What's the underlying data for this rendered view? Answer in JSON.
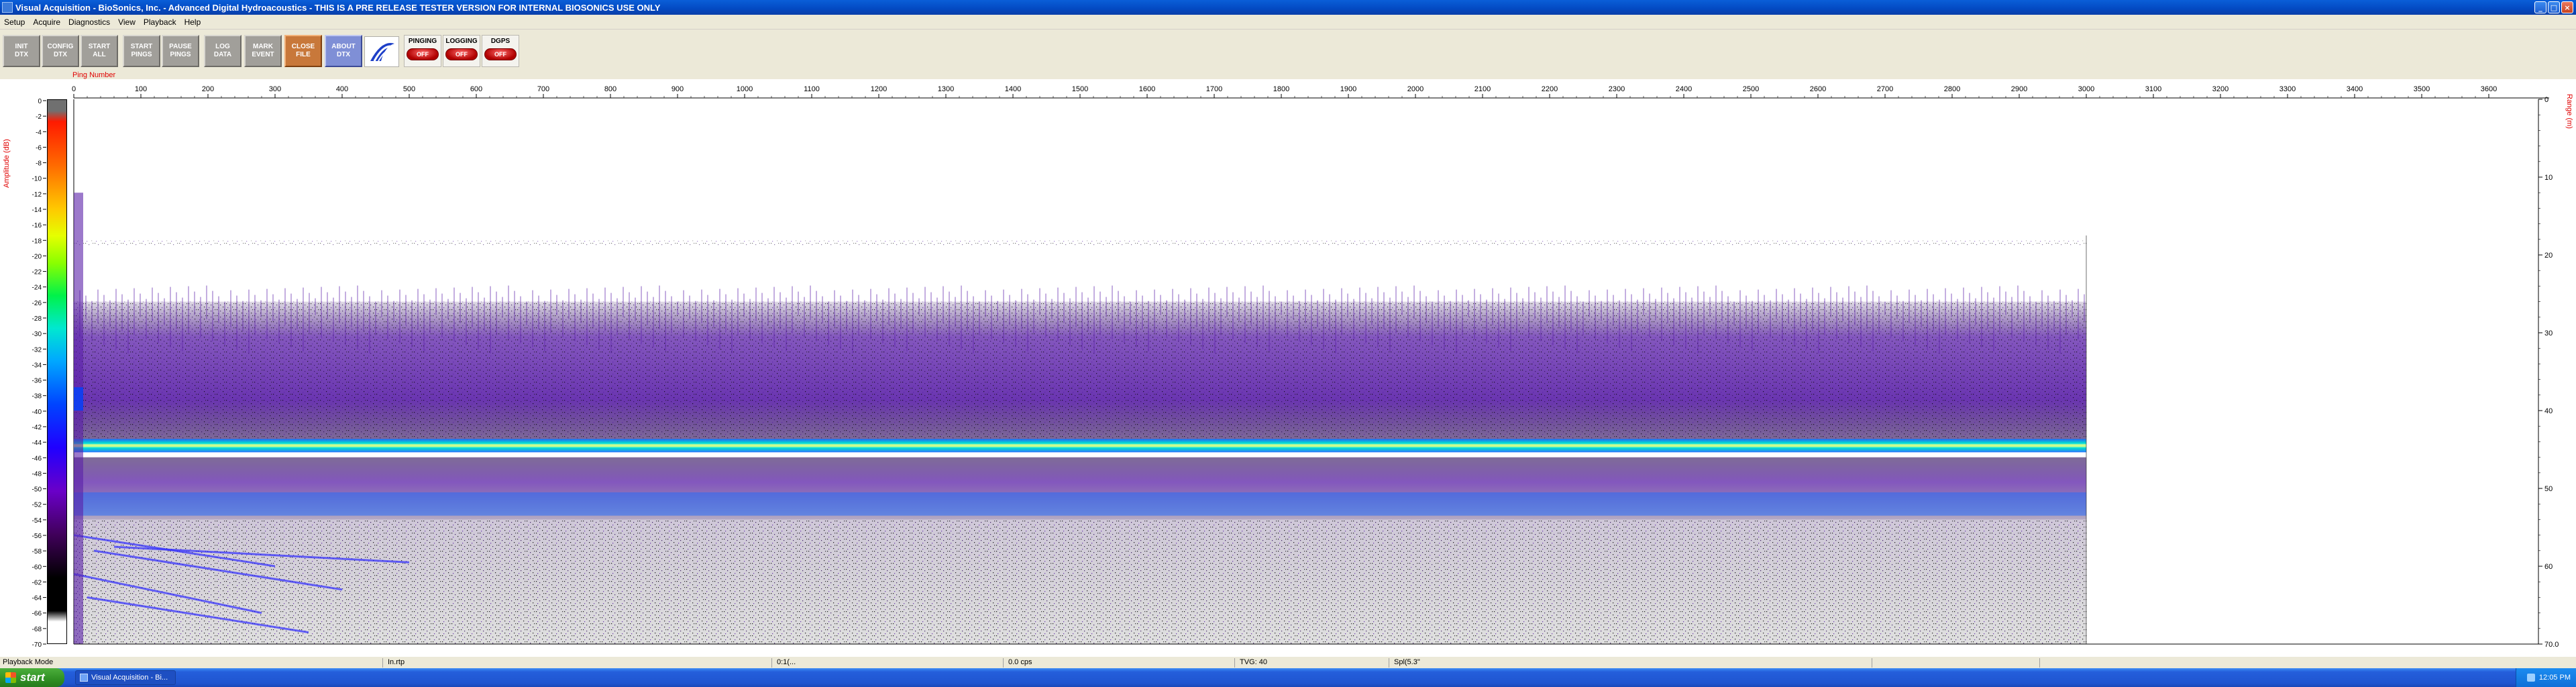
{
  "window": {
    "title": "Visual Acquisition  -  BioSonics, Inc.  -  Advanced Digital Hydroacoustics  -  THIS IS A PRE RELEASE TESTER VERSION FOR INTERNAL BIOSONICS USE ONLY",
    "app_icon": "app-icon"
  },
  "menu": [
    "Setup",
    "Acquire",
    "Diagnostics",
    "View",
    "Playback",
    "Help"
  ],
  "toolbar": {
    "buttons": [
      {
        "line1": "INIT",
        "line2": "DTX"
      },
      {
        "line1": "CONFIG",
        "line2": "DTX"
      },
      {
        "line1": "START",
        "line2": "ALL"
      },
      {
        "line1": "START",
        "line2": "PINGS"
      },
      {
        "line1": "PAUSE",
        "line2": "PINGS"
      },
      {
        "line1": "LOG",
        "line2": "DATA"
      },
      {
        "line1": "MARK",
        "line2": "EVENT"
      },
      {
        "line1": "CLOSE",
        "line2": "FILE"
      },
      {
        "line1": "ABOUT",
        "line2": "DTX"
      }
    ],
    "indicators": [
      {
        "label": "PINGING",
        "state": "OFF"
      },
      {
        "label": "LOGGING",
        "state": "OFF"
      },
      {
        "label": "DGPS",
        "state": "OFF"
      }
    ]
  },
  "plot": {
    "ping_label": "Ping Number",
    "amplitude_label": "Amplitude (dB)",
    "range_label": "Range (m)",
    "ping_ticks": [
      "0",
      "100",
      "200",
      "300",
      "400",
      "500",
      "600",
      "700",
      "800",
      "900",
      "1000",
      "1100",
      "1200",
      "1300",
      "1400",
      "1500",
      "1600",
      "1700",
      "1800",
      "1900",
      "2000",
      "2100",
      "2200",
      "2300",
      "2400",
      "2500",
      "2600",
      "2700",
      "2800",
      "2900",
      "3000",
      "3100",
      "3200",
      "3300",
      "3400",
      "3500",
      "3600"
    ],
    "amplitude_ticks": [
      "0",
      "-2",
      "-4",
      "-6",
      "-8",
      "-10",
      "-12",
      "-14",
      "-16",
      "-18",
      "-20",
      "-22",
      "-24",
      "-26",
      "-28",
      "-30",
      "-32",
      "-34",
      "-36",
      "-38",
      "-40",
      "-42",
      "-44",
      "-46",
      "-48",
      "-50",
      "-52",
      "-54",
      "-56",
      "-58",
      "-60",
      "-62",
      "-64",
      "-66",
      "-68",
      "-70"
    ],
    "range_ticks": [
      "0",
      "10",
      "20",
      "30",
      "40",
      "50",
      "60",
      "70.0"
    ],
    "data_extent_pings": 3000,
    "bottom_line_range_m": 44.5,
    "surface_echo_range_m": 18.5,
    "colors": {
      "bottom_line": "#00d8d0",
      "bottom_core": "#1a6aff",
      "echo_purple": "#5a1fa8",
      "echo_dark": "#2a0a55"
    }
  },
  "status": {
    "mode": "Playback Mode",
    "fields": [
      "In.rtp",
      "0:1(...",
      "0.0 cps",
      "TVG: 40",
      "Spl(5.3\""
    ]
  },
  "taskbar": {
    "start_label": "start",
    "task_label": "Visual Acquisition  -  Bi...",
    "clock": "12:05 PM"
  }
}
